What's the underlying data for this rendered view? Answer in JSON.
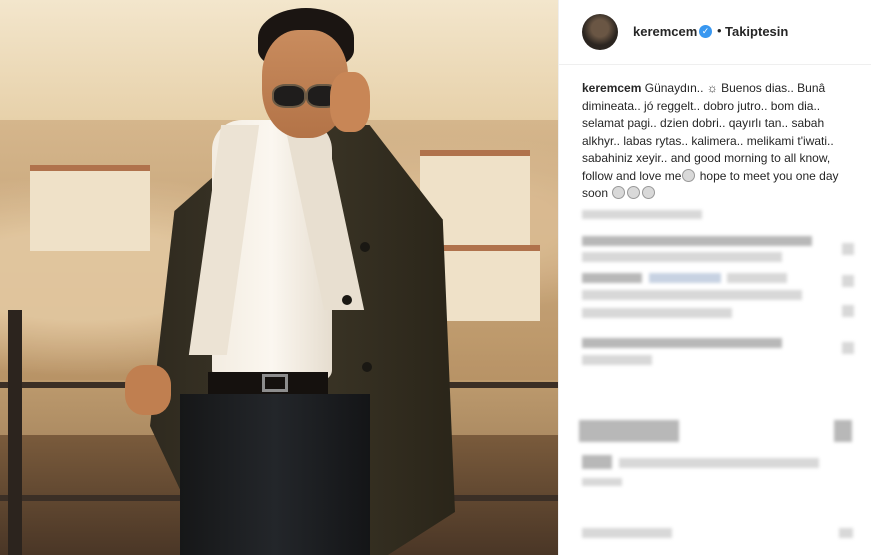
{
  "post": {
    "username": "keremcem",
    "verified_icon": "verified-check-icon",
    "separator": "•",
    "follow_status": "Takiptesin",
    "caption_username": "keremcem",
    "caption_text": "Günaydın.. ☼ Buenos dias.. Bunâ dimineata.. jó reggelt.. dobro jutro.. bom dia.. selamat pagi.. dzien dobri.. qayırlı tan.. sabah alkhyr.. labas rytas.. kalimera.. melikami t'iwati.. sabahiniz xeyir.. and good morning to all know, follow and love me",
    "caption_text_2": " hope to meet you one day soon",
    "emoji_icons": [
      "wink-emoji-icon",
      "people-emoji-icon",
      "raised-hands-emoji-icon",
      "kiss-emoji-icon"
    ]
  }
}
